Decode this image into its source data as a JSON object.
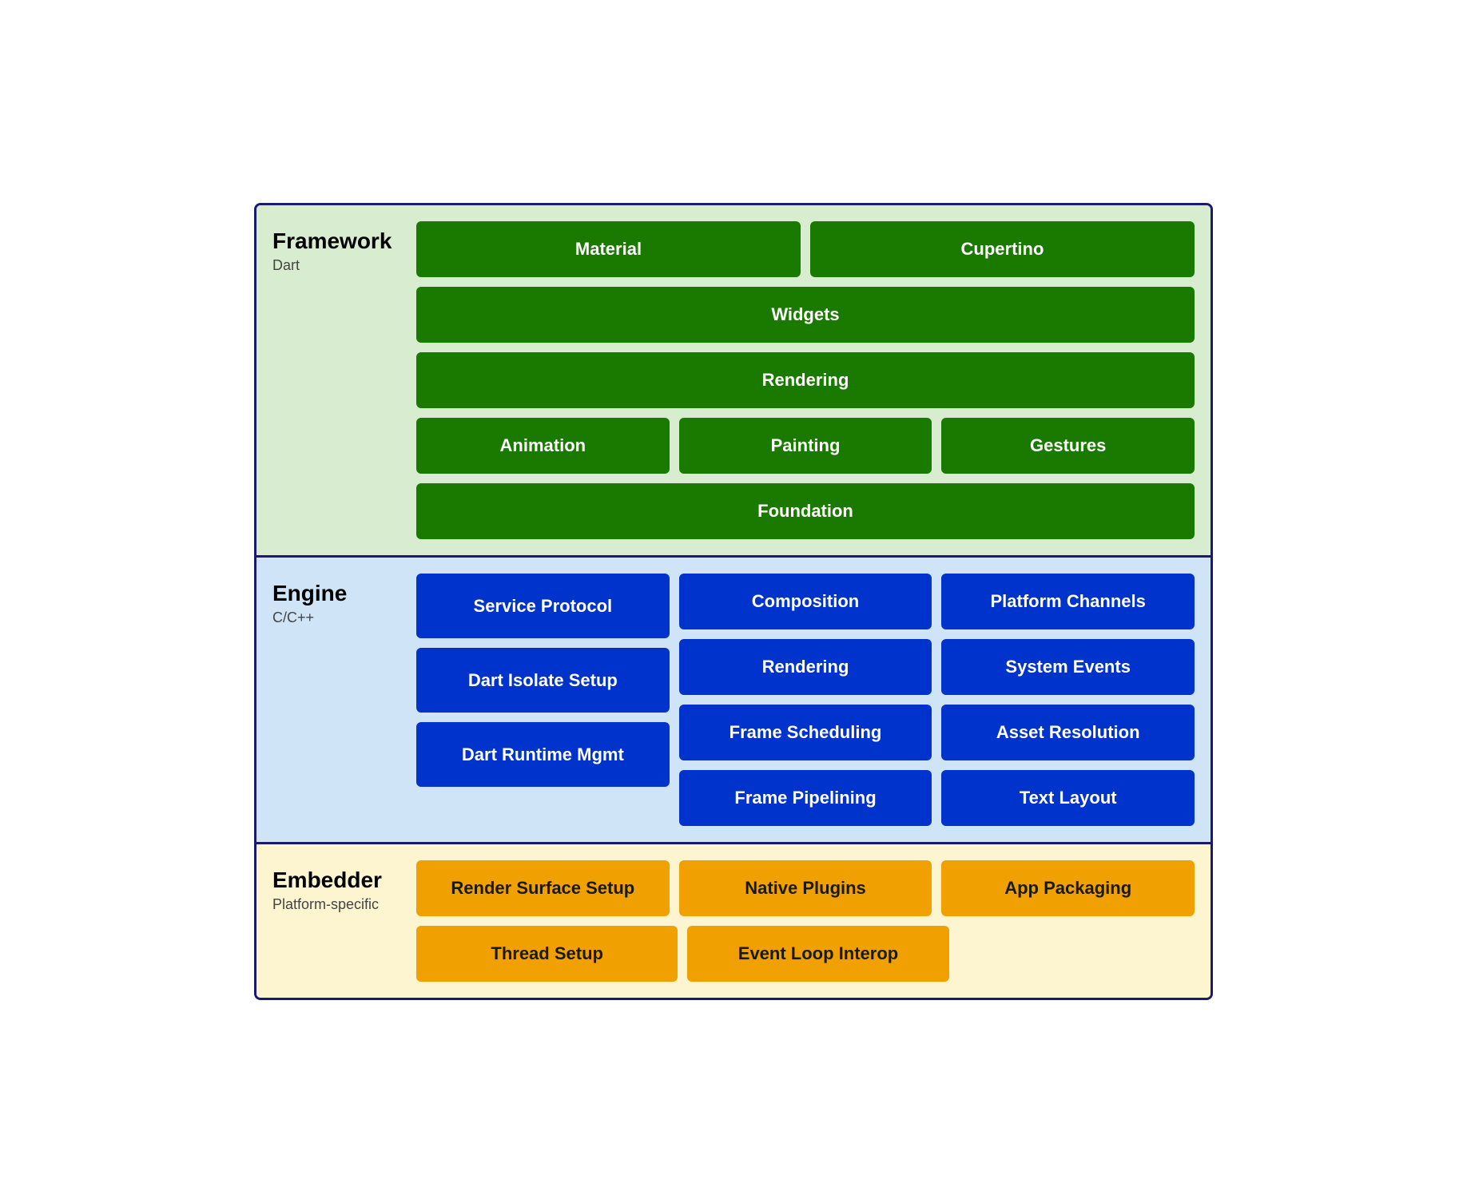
{
  "framework": {
    "title": "Framework",
    "subtitle": "Dart",
    "row1": [
      "Material",
      "Cupertino"
    ],
    "row2": [
      "Widgets"
    ],
    "row3": [
      "Rendering"
    ],
    "row4": [
      "Animation",
      "Painting",
      "Gestures"
    ],
    "row5": [
      "Foundation"
    ]
  },
  "engine": {
    "title": "Engine",
    "subtitle": "C/C++",
    "col_left": [
      "Service Protocol",
      "Dart Isolate Setup",
      "Dart Runtime Mgmt"
    ],
    "col_mid": [
      "Composition",
      "Rendering",
      "Frame Scheduling",
      "Frame Pipelining"
    ],
    "col_right": [
      "Platform Channels",
      "System Events",
      "Asset Resolution",
      "Text Layout"
    ]
  },
  "embedder": {
    "title": "Embedder",
    "subtitle": "Platform-specific",
    "row1": [
      "Render Surface Setup",
      "Native Plugins",
      "App Packaging"
    ],
    "row2": [
      "Thread Setup",
      "Event Loop Interop"
    ]
  }
}
